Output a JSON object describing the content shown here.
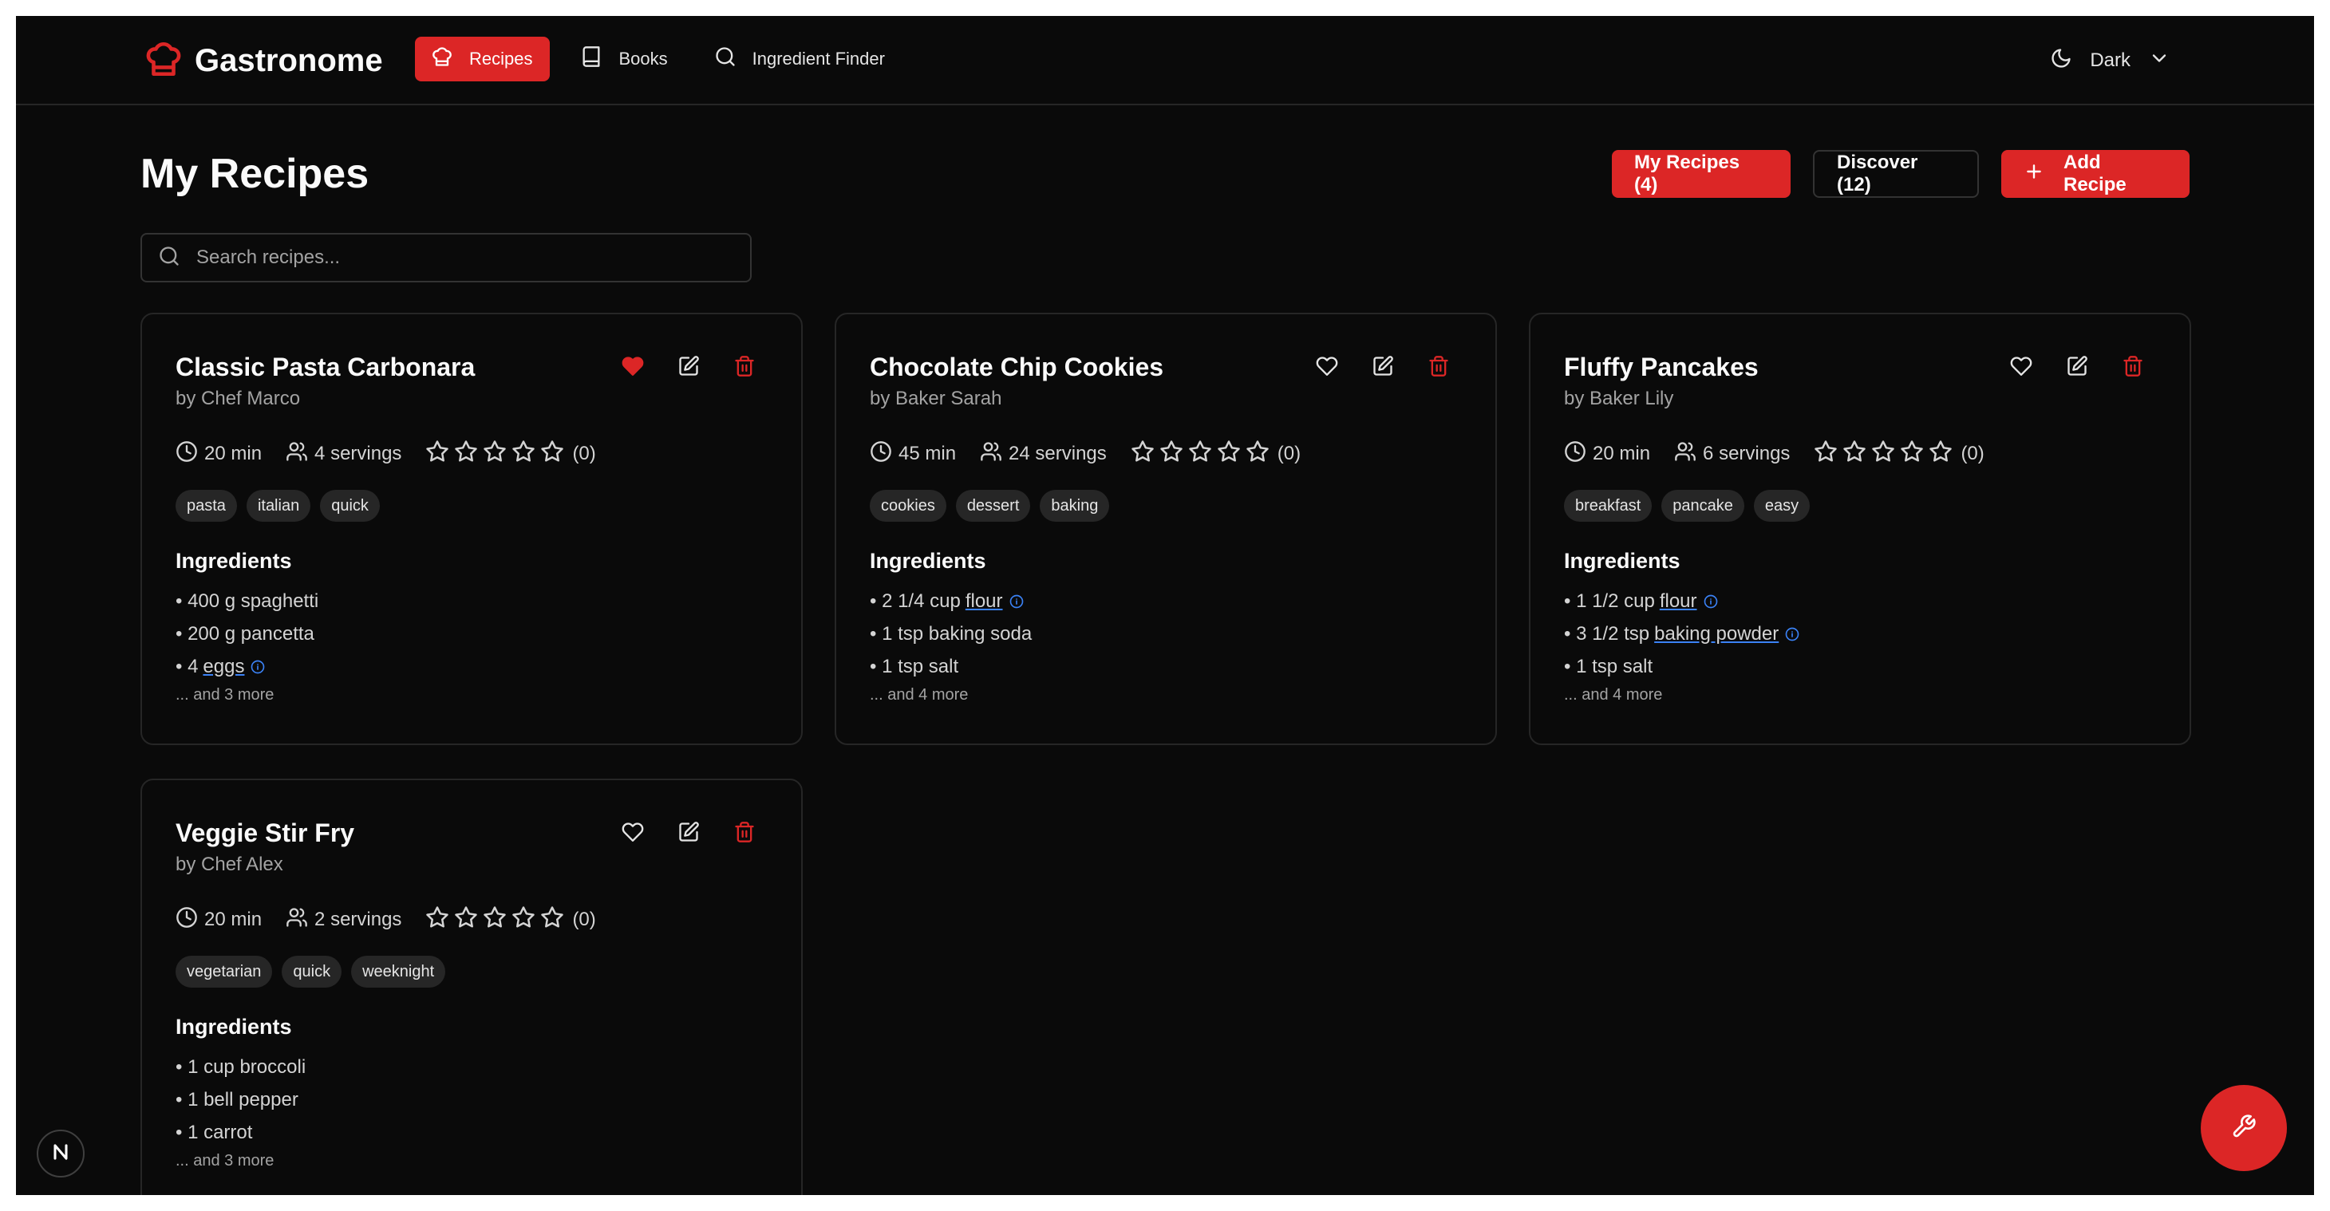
{
  "app": {
    "name": "Gastronome",
    "accent": "#dc2626"
  },
  "nav": {
    "items": [
      {
        "label": "Recipes",
        "icon": "chef-hat-icon",
        "active": true
      },
      {
        "label": "Books",
        "icon": "book-icon",
        "active": false
      },
      {
        "label": "Ingredient Finder",
        "icon": "search-icon",
        "active": false
      }
    ],
    "theme_label": "Dark"
  },
  "page": {
    "title": "My Recipes",
    "my_recipes_label": "My Recipes (4)",
    "discover_label": "Discover (12)",
    "add_label": "Add Recipe",
    "search_placeholder": "Search recipes..."
  },
  "recipes": [
    {
      "title": "Classic Pasta Carbonara",
      "author": "by Chef Marco",
      "time": "20 min",
      "servings": "4 servings",
      "rating_count": "(0)",
      "favorited": true,
      "tags": [
        "pasta",
        "italian",
        "quick"
      ],
      "ingredients_heading": "Ingredients",
      "ingredients": [
        {
          "prefix": "• 400 g spaghetti",
          "link": "",
          "info": false
        },
        {
          "prefix": "• 200 g pancetta",
          "link": "",
          "info": false
        },
        {
          "prefix": "• 4",
          "link": "eggs",
          "info": true
        }
      ],
      "more": "... and 3 more"
    },
    {
      "title": "Chocolate Chip Cookies",
      "author": "by Baker Sarah",
      "time": "45 min",
      "servings": "24 servings",
      "rating_count": "(0)",
      "favorited": false,
      "tags": [
        "cookies",
        "dessert",
        "baking"
      ],
      "ingredients_heading": "Ingredients",
      "ingredients": [
        {
          "prefix": "• 2 1/4 cup",
          "link": "flour",
          "info": true
        },
        {
          "prefix": "• 1 tsp baking soda",
          "link": "",
          "info": false
        },
        {
          "prefix": "• 1 tsp salt",
          "link": "",
          "info": false
        }
      ],
      "more": "... and 4 more"
    },
    {
      "title": "Fluffy Pancakes",
      "author": "by Baker Lily",
      "time": "20 min",
      "servings": "6 servings",
      "rating_count": "(0)",
      "favorited": false,
      "tags": [
        "breakfast",
        "pancake",
        "easy"
      ],
      "ingredients_heading": "Ingredients",
      "ingredients": [
        {
          "prefix": "• 1 1/2 cup",
          "link": "flour",
          "info": true
        },
        {
          "prefix": "• 3 1/2 tsp",
          "link": "baking powder",
          "info": true
        },
        {
          "prefix": "• 1 tsp salt",
          "link": "",
          "info": false
        }
      ],
      "more": "... and 4 more"
    },
    {
      "title": "Veggie Stir Fry",
      "author": "by Chef Alex",
      "time": "20 min",
      "servings": "2 servings",
      "rating_count": "(0)",
      "favorited": false,
      "tags": [
        "vegetarian",
        "quick",
        "weeknight"
      ],
      "ingredients_heading": "Ingredients",
      "ingredients": [
        {
          "prefix": "• 1 cup broccoli",
          "link": "",
          "info": false
        },
        {
          "prefix": "• 1 bell pepper",
          "link": "",
          "info": false
        },
        {
          "prefix": "• 1 carrot",
          "link": "",
          "info": false
        }
      ],
      "more": "... and 3 more"
    }
  ]
}
